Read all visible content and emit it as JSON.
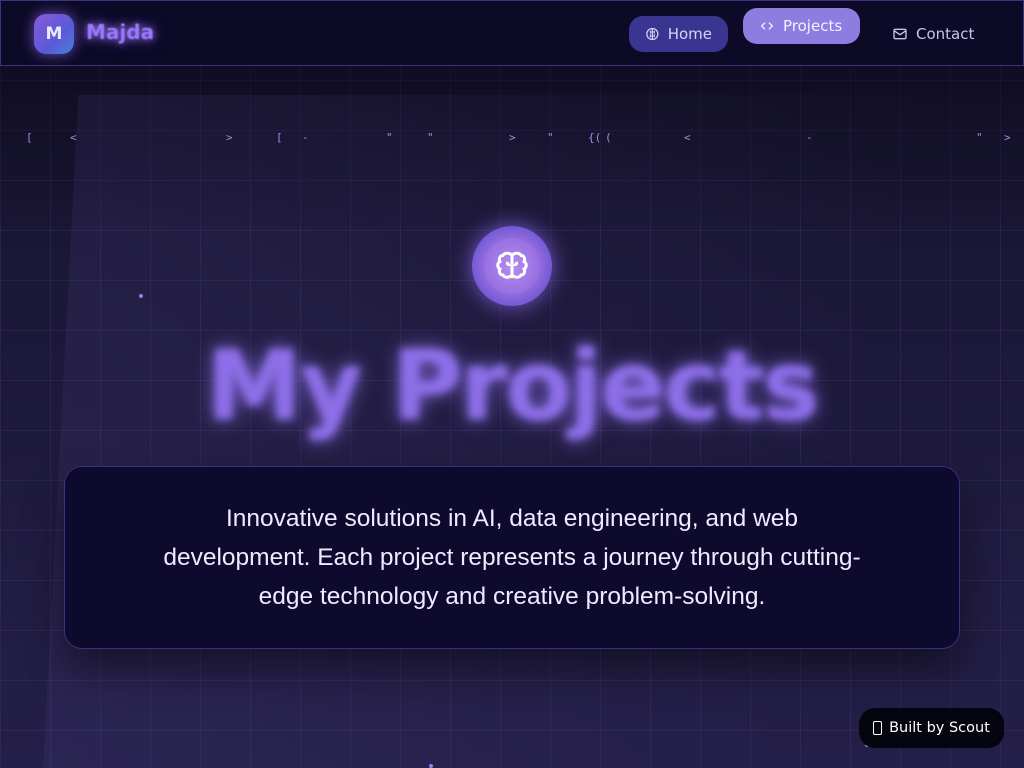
{
  "nav": {
    "logo_letter": "M",
    "brand": "Majda",
    "items": [
      {
        "label": "Home",
        "icon": "brain-icon"
      },
      {
        "label": "Projects",
        "icon": "code-icon",
        "active": true
      },
      {
        "label": "Contact",
        "icon": "mail-icon"
      }
    ]
  },
  "code_rain": [
    "[",
    "<",
    ">",
    "[",
    "-",
    "\"",
    "\"",
    ">",
    "\"",
    "{(",
    "(",
    "<",
    "-",
    "\"",
    ">"
  ],
  "hero": {
    "icon": "brain-icon",
    "title": "My Projects",
    "description": "Innovative solutions in AI, data engineering, and web development. Each project represents a journey through cutting-edge technology and creative problem-solving."
  },
  "badge": {
    "label": "Built by Scout"
  },
  "colors": {
    "accent": "#8d7de0",
    "title": "#8d6fe8",
    "background": "#1c1838",
    "card": "#0e0a2e"
  }
}
